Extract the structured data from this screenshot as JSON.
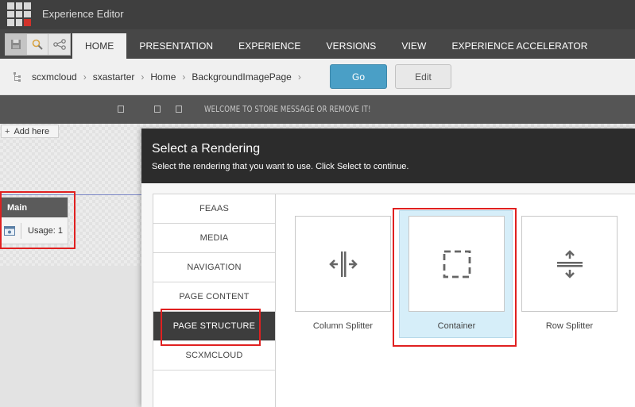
{
  "app": {
    "title": "Experience Editor"
  },
  "ribbon": {
    "tabs": [
      {
        "label": "HOME",
        "active": true
      },
      {
        "label": "PRESENTATION",
        "active": false
      },
      {
        "label": "EXPERIENCE",
        "active": false
      },
      {
        "label": "VERSIONS",
        "active": false
      },
      {
        "label": "VIEW",
        "active": false
      },
      {
        "label": "EXPERIENCE ACCELERATOR",
        "active": false
      }
    ]
  },
  "breadcrumb": {
    "items": [
      "scxmcloud",
      "sxastarter",
      "Home",
      "BackgroundImagePage"
    ],
    "go_label": "Go",
    "edit_label": "Edit"
  },
  "site_header": {
    "message": "WELCOME TO STORE MESSAGE OR REMOVE IT!"
  },
  "canvas": {
    "add_here_label": "Add here",
    "placeholder": {
      "name": "Main",
      "usage": "Usage: 1"
    }
  },
  "dialog": {
    "title": "Select a Rendering",
    "subtitle": "Select the rendering that you want to use. Click Select to continue.",
    "categories": [
      "FEAAS",
      "MEDIA",
      "NAVIGATION",
      "PAGE CONTENT",
      "PAGE STRUCTURE",
      "SCXMCLOUD"
    ],
    "selected_category": "PAGE STRUCTURE",
    "renderings": [
      "Column Splitter",
      "Container",
      "Row Splitter"
    ],
    "selected_rendering": "Container"
  },
  "colors": {
    "go_button": "#4a9fc6",
    "highlight": "#e02020",
    "selected_tile": "#d6eef9"
  }
}
